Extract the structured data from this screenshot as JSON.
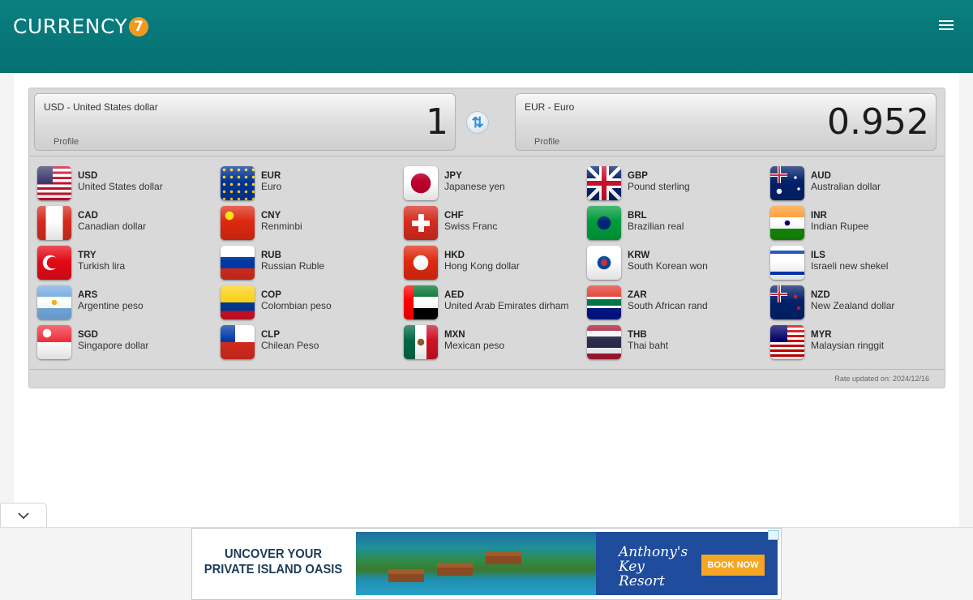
{
  "header": {
    "logo_text": "CURRENCY",
    "logo_badge": "7"
  },
  "converter": {
    "from": {
      "currency": "USD - United States dollar",
      "profile_label": "Profile",
      "value": "1"
    },
    "to": {
      "currency": "EUR - Euro",
      "profile_label": "Profile",
      "value": "0.952"
    }
  },
  "currencies": [
    {
      "code": "USD",
      "name": "United States dollar"
    },
    {
      "code": "EUR",
      "name": "Euro"
    },
    {
      "code": "JPY",
      "name": "Japanese yen"
    },
    {
      "code": "GBP",
      "name": "Pound sterling"
    },
    {
      "code": "AUD",
      "name": "Australian dollar"
    },
    {
      "code": "CAD",
      "name": "Canadian dollar"
    },
    {
      "code": "CNY",
      "name": "Renminbi"
    },
    {
      "code": "CHF",
      "name": "Swiss Franc"
    },
    {
      "code": "BRL",
      "name": "Brazilian real"
    },
    {
      "code": "INR",
      "name": "Indian Rupee"
    },
    {
      "code": "TRY",
      "name": "Turkish lira"
    },
    {
      "code": "RUB",
      "name": "Russian Ruble"
    },
    {
      "code": "HKD",
      "name": "Hong Kong dollar"
    },
    {
      "code": "KRW",
      "name": "South Korean won"
    },
    {
      "code": "ILS",
      "name": "Israeli new shekel"
    },
    {
      "code": "ARS",
      "name": "Argentine peso"
    },
    {
      "code": "COP",
      "name": "Colombian peso"
    },
    {
      "code": "AED",
      "name": "United Arab Emirates dirham"
    },
    {
      "code": "ZAR",
      "name": "South African rand"
    },
    {
      "code": "NZD",
      "name": "New Zealand dollar"
    },
    {
      "code": "SGD",
      "name": "Singapore dollar"
    },
    {
      "code": "CLP",
      "name": "Chilean Peso"
    },
    {
      "code": "MXN",
      "name": "Mexican peso"
    },
    {
      "code": "THB",
      "name": "Thai baht"
    },
    {
      "code": "MYR",
      "name": "Malaysian ringgit"
    }
  ],
  "rate_updated": "Rate updated on: 2024/12/16",
  "ad": {
    "headline": "UNCOVER YOUR PRIVATE ISLAND OASIS",
    "brand": "Anthony's Key Resort",
    "button": "BOOK NOW"
  },
  "colors": {
    "header": "#077878",
    "accent": "#f39a1e",
    "ad_button": "#f5a623"
  },
  "icons": {
    "menu": "hamburger-icon",
    "swap": "swap-arrows-icon",
    "collapse": "chevron-down-icon"
  }
}
